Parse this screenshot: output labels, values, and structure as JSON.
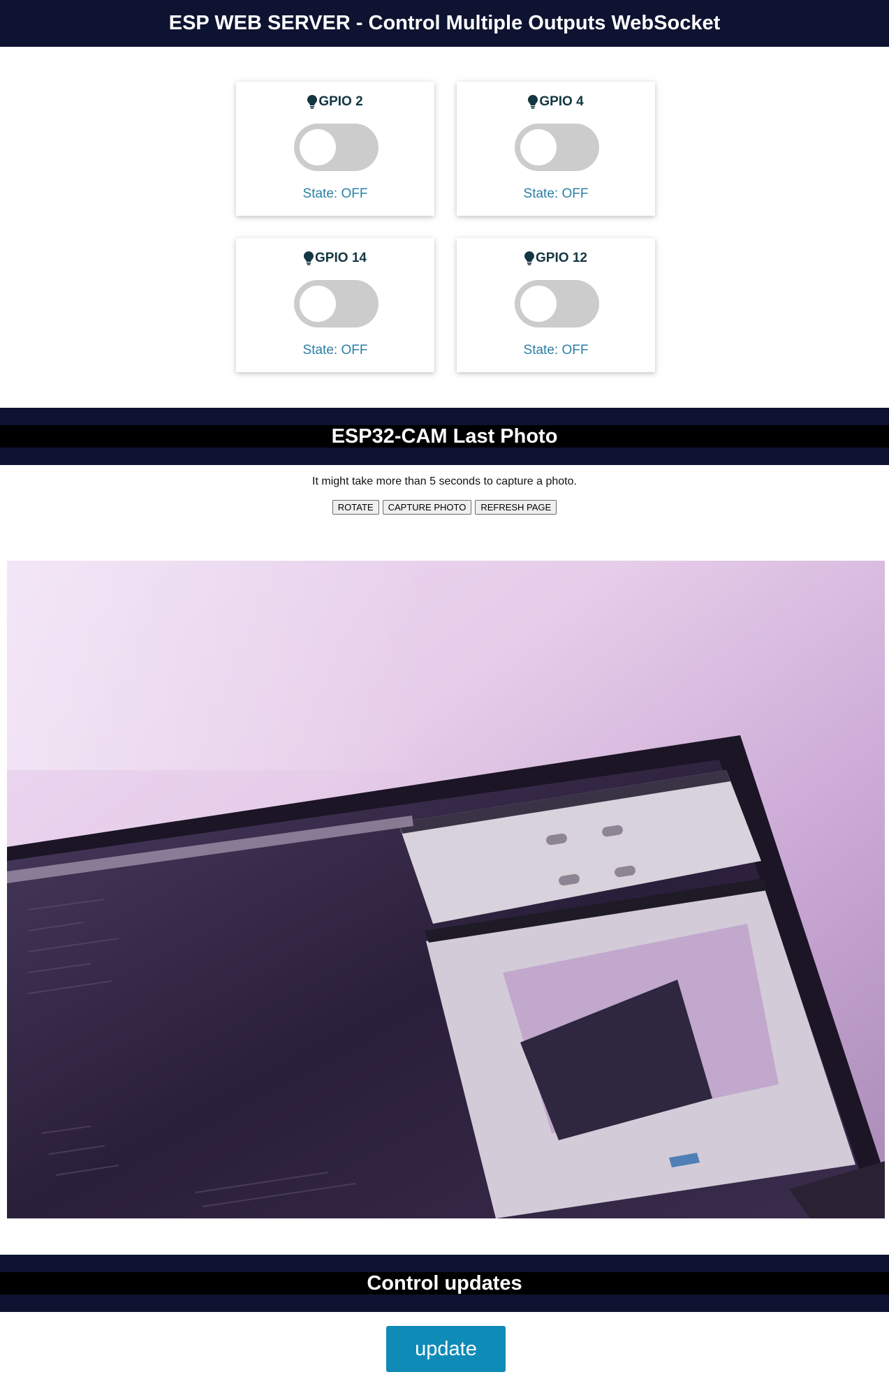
{
  "header": {
    "title": "ESP WEB SERVER - Control Multiple Outputs WebSocket"
  },
  "cards": [
    {
      "label": "GPIO 2",
      "state_text": "State: OFF",
      "on": false
    },
    {
      "label": "GPIO 4",
      "state_text": "State: OFF",
      "on": false
    },
    {
      "label": "GPIO 14",
      "state_text": "State: OFF",
      "on": false
    },
    {
      "label": "GPIO 12",
      "state_text": "State: OFF",
      "on": false
    }
  ],
  "photo_section": {
    "title": "ESP32-CAM Last Photo",
    "note": "It might take more than 5 seconds to capture a photo.",
    "buttons": {
      "rotate": "ROTATE",
      "capture": "CAPTURE PHOTO",
      "refresh": "REFRESH PAGE"
    }
  },
  "control_section": {
    "title": "Control updates",
    "update_label": "update"
  },
  "colors": {
    "header_bg": "#0d1330",
    "card_title": "#143642",
    "state_text": "#2a80a6",
    "switch_off": "#cccccc",
    "update_button": "#0f8bb7"
  },
  "icons": {
    "card_icon": "lightbulb-icon"
  }
}
